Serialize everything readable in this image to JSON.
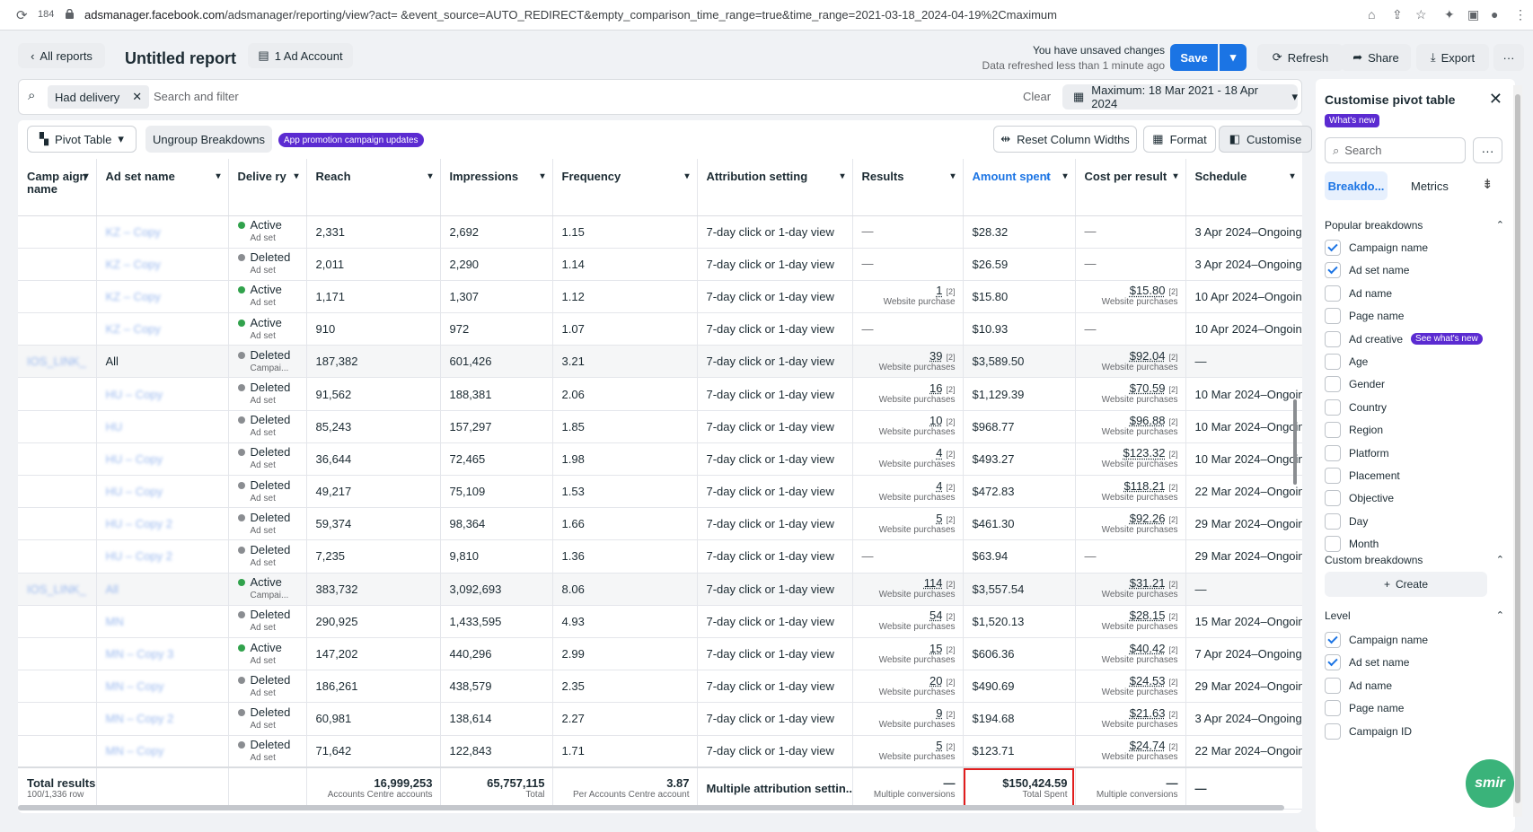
{
  "browser": {
    "tab_count": "184",
    "url_host": "adsmanager.facebook.com",
    "url_rest": "/adsmanager/reporting/view?act=                &event_source=AUTO_REDIRECT&empty_comparison_time_range=true&time_range=2021-03-18_2024-04-19%2Cmaximum"
  },
  "header": {
    "back_label": "All reports",
    "title": "Untitled report",
    "account_label": "1 Ad Account",
    "unsaved": "You have unsaved changes",
    "refreshed": "Data refreshed less than 1 minute ago",
    "save_label": "Save",
    "refresh_label": "Refresh",
    "share_label": "Share",
    "export_label": "Export",
    "more_label": "···"
  },
  "filter": {
    "chip_label": "Had delivery",
    "placeholder": "Search and filter",
    "clear_label": "Clear",
    "date_range": "Maximum: 18 Mar 2021 - 18 Apr 2024"
  },
  "toolbar": {
    "pivot_label": "Pivot Table",
    "ungroup_label": "Ungroup Breakdowns",
    "promo_badge": "App promotion campaign updates",
    "reset_label": "Reset Column Widths",
    "format_label": "Format",
    "customise_label": "Customise"
  },
  "columns": [
    "Camp aign name",
    "Ad set name",
    "Delive ry",
    "Reach",
    "Impressions",
    "Frequency",
    "Attribution setting",
    "Results",
    "Amount spent",
    "Cost per result",
    "Schedule"
  ],
  "rows": [
    {
      "campaign": "",
      "adset": "KZ – Copy",
      "adset_blur": true,
      "status": "Active",
      "level": "Ad set",
      "reach": "2,331",
      "impr": "2,692",
      "freq": "1.15",
      "attr": "7-day click or 1-day view",
      "results": "—",
      "results_sub": "",
      "spent": "$28.32",
      "cpr": "—",
      "cpr_sub": "",
      "sched": "3 Apr 2024–Ongoing",
      "grey": false
    },
    {
      "campaign": "",
      "adset": "KZ – Copy",
      "adset_blur": true,
      "status": "Deleted",
      "level": "Ad set",
      "reach": "2,011",
      "impr": "2,290",
      "freq": "1.14",
      "attr": "7-day click or 1-day view",
      "results": "—",
      "results_sub": "",
      "spent": "$26.59",
      "cpr": "—",
      "cpr_sub": "",
      "sched": "3 Apr 2024–Ongoing",
      "grey": false
    },
    {
      "campaign": "",
      "adset": "KZ – Copy",
      "adset_blur": true,
      "status": "Active",
      "level": "Ad set",
      "reach": "1,171",
      "impr": "1,307",
      "freq": "1.12",
      "attr": "7-day click or 1-day view",
      "results": "1",
      "results_sub": "Website purchase",
      "spent": "$15.80",
      "cpr": "$15.80",
      "cpr_sub": "Website purchases",
      "sched": "10 Apr 2024–Ongoing",
      "grey": false
    },
    {
      "campaign": "",
      "adset": "KZ – Copy",
      "adset_blur": true,
      "status": "Active",
      "level": "Ad set",
      "reach": "910",
      "impr": "972",
      "freq": "1.07",
      "attr": "7-day click or 1-day view",
      "results": "—",
      "results_sub": "",
      "spent": "$10.93",
      "cpr": "—",
      "cpr_sub": "",
      "sched": "10 Apr 2024–Ongoing",
      "grey": false
    },
    {
      "campaign": "IOS_LINK_",
      "adset": "All",
      "adset_blur": false,
      "status": "Deleted",
      "level": "Campai...",
      "reach": "187,382",
      "impr": "601,426",
      "freq": "3.21",
      "attr": "7-day click or 1-day view",
      "results": "39",
      "results_sub": "Website purchases",
      "spent": "$3,589.50",
      "cpr": "$92.04",
      "cpr_sub": "Website purchases",
      "sched": "—",
      "grey": true
    },
    {
      "campaign": "",
      "adset": "HU – Copy",
      "adset_blur": true,
      "status": "Deleted",
      "level": "Ad set",
      "reach": "91,562",
      "impr": "188,381",
      "freq": "2.06",
      "attr": "7-day click or 1-day view",
      "results": "16",
      "results_sub": "Website purchases",
      "spent": "$1,129.39",
      "cpr": "$70.59",
      "cpr_sub": "Website purchases",
      "sched": "10 Mar 2024–Ongoing",
      "grey": false
    },
    {
      "campaign": "",
      "adset": "HU",
      "adset_blur": true,
      "status": "Deleted",
      "level": "Ad set",
      "reach": "85,243",
      "impr": "157,297",
      "freq": "1.85",
      "attr": "7-day click or 1-day view",
      "results": "10",
      "results_sub": "Website purchases",
      "spent": "$968.77",
      "cpr": "$96.88",
      "cpr_sub": "Website purchases",
      "sched": "10 Mar 2024–Ongoing",
      "grey": false
    },
    {
      "campaign": "",
      "adset": "HU – Copy",
      "adset_blur": true,
      "status": "Deleted",
      "level": "Ad set",
      "reach": "36,644",
      "impr": "72,465",
      "freq": "1.98",
      "attr": "7-day click or 1-day view",
      "results": "4",
      "results_sub": "Website purchases",
      "spent": "$493.27",
      "cpr": "$123.32",
      "cpr_sub": "Website purchases",
      "sched": "10 Mar 2024–Ongoing",
      "grey": false
    },
    {
      "campaign": "",
      "adset": "HU – Copy",
      "adset_blur": true,
      "status": "Deleted",
      "level": "Ad set",
      "reach": "49,217",
      "impr": "75,109",
      "freq": "1.53",
      "attr": "7-day click or 1-day view",
      "results": "4",
      "results_sub": "Website purchases",
      "spent": "$472.83",
      "cpr": "$118.21",
      "cpr_sub": "Website purchases",
      "sched": "22 Mar 2024–Ongoing",
      "grey": false
    },
    {
      "campaign": "",
      "adset": "HU – Copy 2",
      "adset_blur": true,
      "status": "Deleted",
      "level": "Ad set",
      "reach": "59,374",
      "impr": "98,364",
      "freq": "1.66",
      "attr": "7-day click or 1-day view",
      "results": "5",
      "results_sub": "Website purchases",
      "spent": "$461.30",
      "cpr": "$92.26",
      "cpr_sub": "Website purchases",
      "sched": "29 Mar 2024–Ongoing",
      "grey": false
    },
    {
      "campaign": "",
      "adset": "HU – Copy 2",
      "adset_blur": true,
      "status": "Deleted",
      "level": "Ad set",
      "reach": "7,235",
      "impr": "9,810",
      "freq": "1.36",
      "attr": "7-day click or 1-day view",
      "results": "—",
      "results_sub": "",
      "spent": "$63.94",
      "cpr": "—",
      "cpr_sub": "",
      "sched": "29 Mar 2024–Ongoing",
      "grey": false
    },
    {
      "campaign": "IOS_LINK_",
      "adset": "All",
      "adset_blur": true,
      "status": "Active",
      "level": "Campai...",
      "reach": "383,732",
      "impr": "3,092,693",
      "freq": "8.06",
      "attr": "7-day click or 1-day view",
      "results": "114",
      "results_sub": "Website purchases",
      "spent": "$3,557.54",
      "cpr": "$31.21",
      "cpr_sub": "Website purchases",
      "sched": "—",
      "grey": true
    },
    {
      "campaign": "",
      "adset": "MN",
      "adset_blur": true,
      "status": "Deleted",
      "level": "Ad set",
      "reach": "290,925",
      "impr": "1,433,595",
      "freq": "4.93",
      "attr": "7-day click or 1-day view",
      "results": "54",
      "results_sub": "Website purchases",
      "spent": "$1,520.13",
      "cpr": "$28.15",
      "cpr_sub": "Website purchases",
      "sched": "15 Mar 2024–Ongoing",
      "grey": false
    },
    {
      "campaign": "",
      "adset": "MN – Copy 3",
      "adset_blur": true,
      "status": "Active",
      "level": "Ad set",
      "reach": "147,202",
      "impr": "440,296",
      "freq": "2.99",
      "attr": "7-day click or 1-day view",
      "results": "15",
      "results_sub": "Website purchases",
      "spent": "$606.36",
      "cpr": "$40.42",
      "cpr_sub": "Website purchases",
      "sched": "7 Apr 2024–Ongoing",
      "grey": false
    },
    {
      "campaign": "",
      "adset": "MN – Copy",
      "adset_blur": true,
      "status": "Deleted",
      "level": "Ad set",
      "reach": "186,261",
      "impr": "438,579",
      "freq": "2.35",
      "attr": "7-day click or 1-day view",
      "results": "20",
      "results_sub": "Website purchases",
      "spent": "$490.69",
      "cpr": "$24.53",
      "cpr_sub": "Website purchases",
      "sched": "29 Mar 2024–Ongoing",
      "grey": false
    },
    {
      "campaign": "",
      "adset": "MN – Copy 2",
      "adset_blur": true,
      "status": "Deleted",
      "level": "Ad set",
      "reach": "60,981",
      "impr": "138,614",
      "freq": "2.27",
      "attr": "7-day click or 1-day view",
      "results": "9",
      "results_sub": "Website purchases",
      "spent": "$194.68",
      "cpr": "$21.63",
      "cpr_sub": "Website purchases",
      "sched": "3 Apr 2024–Ongoing",
      "grey": false
    },
    {
      "campaign": "",
      "adset": "MN – Copy",
      "adset_blur": true,
      "status": "Deleted",
      "level": "Ad set",
      "reach": "71,642",
      "impr": "122,843",
      "freq": "1.71",
      "attr": "7-day click or 1-day view",
      "results": "5",
      "results_sub": "Website purchases",
      "spent": "$123.71",
      "cpr": "$24.74",
      "cpr_sub": "Website purchases",
      "sched": "22 Mar 2024–Ongoing",
      "grey": false
    }
  ],
  "totals": {
    "label": "Total results",
    "sub": "100/1,336 row",
    "reach": "16,999,253",
    "reach_sub": "Accounts Centre accounts",
    "impr": "65,757,115",
    "impr_sub": "Total",
    "freq": "3.87",
    "freq_sub": "Per Accounts Centre account",
    "attr": "Multiple attribution settin...",
    "results": "—",
    "results_sub": "Multiple conversions",
    "spent": "$150,424.59",
    "spent_sub": "Total Spent",
    "cpr": "—",
    "cpr_sub": "Multiple conversions",
    "sched": "—"
  },
  "panel": {
    "title": "Customise pivot table",
    "whats_new": "What's new",
    "search_placeholder": "Search",
    "tab_breakdowns": "Breakdo...",
    "tab_metrics": "Metrics",
    "popular_heading": "Popular breakdowns",
    "popular": [
      {
        "label": "Campaign name",
        "checked": true
      },
      {
        "label": "Ad set name",
        "checked": true
      },
      {
        "label": "Ad name",
        "checked": false
      },
      {
        "label": "Page name",
        "checked": false
      },
      {
        "label": "Ad creative",
        "checked": false,
        "badge": "See what's new"
      },
      {
        "label": "Age",
        "checked": false
      },
      {
        "label": "Gender",
        "checked": false
      },
      {
        "label": "Country",
        "checked": false
      },
      {
        "label": "Region",
        "checked": false
      },
      {
        "label": "Platform",
        "checked": false
      },
      {
        "label": "Placement",
        "checked": false
      },
      {
        "label": "Objective",
        "checked": false
      },
      {
        "label": "Day",
        "checked": false
      },
      {
        "label": "Month",
        "checked": false
      }
    ],
    "custom_heading": "Custom breakdowns",
    "create_label": "Create",
    "level_heading": "Level",
    "level": [
      {
        "label": "Campaign name",
        "checked": true
      },
      {
        "label": "Ad set name",
        "checked": true
      },
      {
        "label": "Ad name",
        "checked": false
      },
      {
        "label": "Page name",
        "checked": false
      },
      {
        "label": "Campaign ID",
        "checked": false
      }
    ]
  },
  "smir_label": "smir",
  "colors": {
    "accent": "#1b74e4",
    "purple": "#5b2bd1",
    "active": "#31a24c",
    "highlight": "#e11d1d"
  }
}
